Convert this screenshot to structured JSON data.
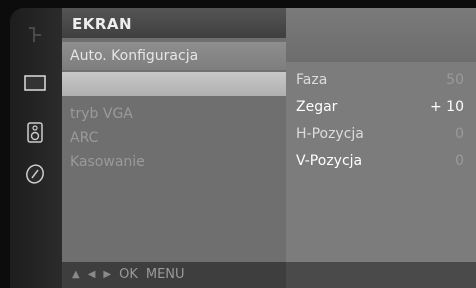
{
  "menu": {
    "title": "EKRAN",
    "auto_config": "Auto. Konfiguracja",
    "items": [
      {
        "label": "tryb VGA"
      },
      {
        "label": "ARC"
      },
      {
        "label": "Kasowanie"
      }
    ]
  },
  "settings": [
    {
      "label": "Faza",
      "value": "50"
    },
    {
      "label": "Zegar",
      "value": "+ 10"
    },
    {
      "label": "H-Pozycja",
      "value": "0"
    },
    {
      "label": "V-Pozycja",
      "value": "0"
    }
  ],
  "footer": {
    "ok": "OK",
    "menu": "MENU"
  },
  "icons": [
    "source-icon",
    "screen-icon",
    "speaker-icon",
    "clock-icon"
  ],
  "colors": {
    "panel": "#6f6f6f",
    "selected": "#c0c0c0",
    "text": "#e6e6e6"
  }
}
